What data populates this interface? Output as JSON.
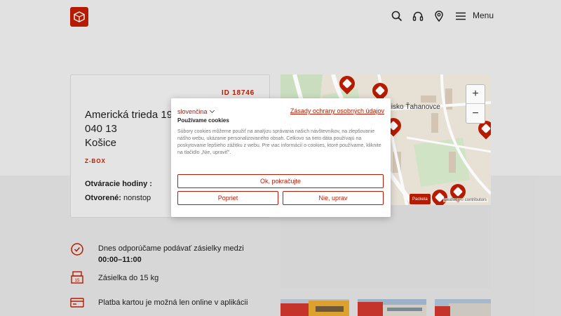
{
  "header": {
    "menu_label": "Menu",
    "icons": [
      "search-icon",
      "headset-icon",
      "location-pin-icon",
      "hamburger-icon"
    ]
  },
  "pickup_point": {
    "id_label": "ID 18746",
    "street": "Americká trieda 19",
    "zip": "040 13",
    "city": "Košice",
    "type": "Z-BOX",
    "opening_hours_label": "Otváracie hodiny :",
    "open_label": "Otvorené:",
    "open_value": "nonstop"
  },
  "map": {
    "district_label": "dlisko Ťahanovce",
    "zoom_in": "+",
    "zoom_out": "−",
    "badge_label": "Packeta",
    "attribution": "Leaflet | © contributors"
  },
  "features": [
    {
      "text": "Dnes odporúčame podávať zásielky medzi ",
      "bold": "00:00–11:00",
      "icon": "clock-icon"
    },
    {
      "text": "Zásielka do 15 kg",
      "bold": "",
      "icon": "weight-icon"
    },
    {
      "text": "Platba kartou je možná len online v aplikácii",
      "bold": "",
      "icon": "card-icon"
    }
  ],
  "cookie": {
    "language": "slovenčina",
    "policy_link": "Zásady ochrany osobných údajov",
    "title": "Používame cookies",
    "text": "Súbory cookies môžeme použiť na analýzu správania našich návštevníkov, na zlepšovanie nášho webu, ukázanie personalizovaného obsah. Celkovo sa tieto dáta používajú na poskytovanie lepšieho zážitku z webu. Pre viac informácií o cookies, ktoré používame, kliknite na tlačidlo „Nie, upraviť\".",
    "accept_label": "Ok, pokračujte",
    "reject_label": "Popriet",
    "customize_label": "Nie, uprav"
  },
  "colors": {
    "accent": "#ba1b02",
    "background": "#e6e6e6"
  }
}
